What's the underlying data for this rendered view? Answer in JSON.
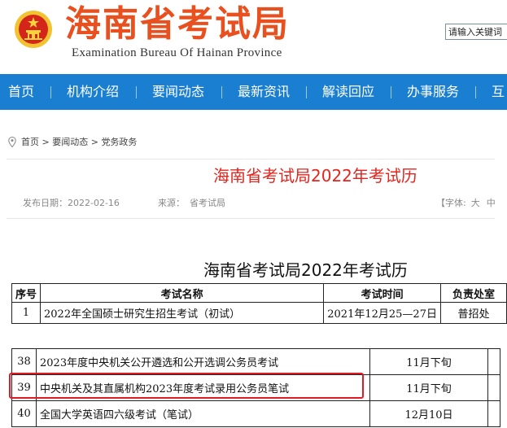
{
  "header": {
    "site_title": "海南省考试局",
    "site_subtitle": "Examination Bureau Of Hainan Province",
    "search_placeholder": "请输入关键词"
  },
  "nav": {
    "items": [
      {
        "label": "首页"
      },
      {
        "label": "机构介绍"
      },
      {
        "label": "要闻动态"
      },
      {
        "label": "最新资讯"
      },
      {
        "label": "解读回应"
      },
      {
        "label": "办事服务"
      },
      {
        "label": "互"
      }
    ]
  },
  "breadcrumb": {
    "items": [
      "首页",
      "要闻动态",
      "党务政务"
    ],
    "separator": ">"
  },
  "article": {
    "title": "海南省考试局2022年考试历",
    "publish_label": "发布日期：",
    "publish_date": "2022-02-16",
    "source_label": "来源：",
    "source": "省考试局",
    "font_label": "【字体:",
    "font_large": "大",
    "font_medium": "中"
  },
  "calendar": {
    "title": "海南省考试局2022年考试历",
    "headers": [
      "序号",
      "考试名称",
      "考试时间",
      "负责处室"
    ],
    "top_rows": [
      {
        "num": "1",
        "name": "2022年全国硕士研究生招生考试（初试）",
        "time": "2021年12月25—27日",
        "dept": "普招处"
      }
    ],
    "bottom_rows": [
      {
        "num": "38",
        "name": "2023年度中央机关公开遴选和公开选调公务员考试",
        "time": "11月下旬"
      },
      {
        "num": "39",
        "name": "中央机关及其直属机构2023年度考试录用公务员笔试",
        "time": "11月下旬"
      },
      {
        "num": "40",
        "name": "全国大学英语四六级考试（笔试）",
        "time": "12月10日"
      }
    ]
  },
  "colors": {
    "brand_orange": "#e8511f",
    "nav_blue": "#1a7fd0",
    "title_red": "#e2251d",
    "highlight_red": "#e01b24"
  },
  "icons": [
    "national-emblem-icon",
    "location-pin-icon"
  ]
}
